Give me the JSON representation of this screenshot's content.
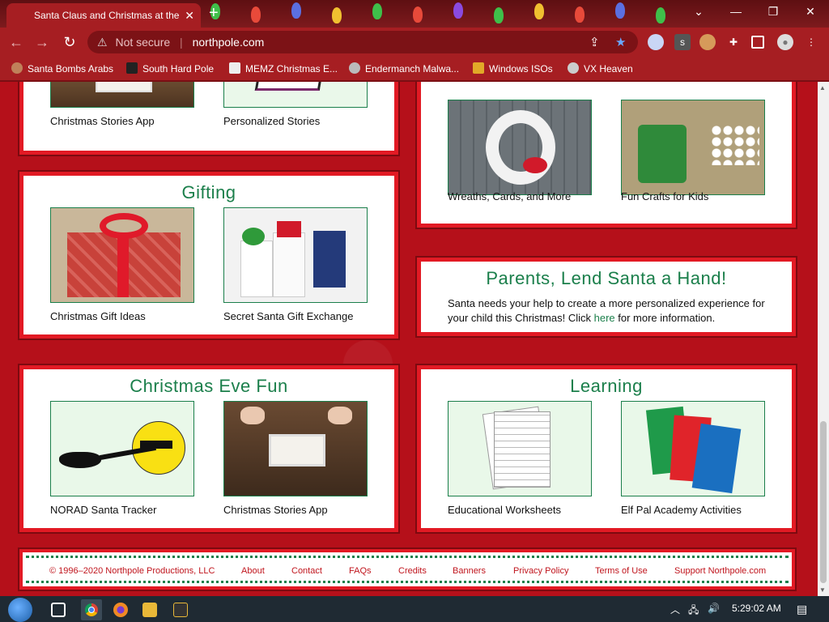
{
  "browser": {
    "tab_title": "Santa Claus and Christmas at the",
    "tab_close": "✕",
    "new_tab": "+",
    "window_controls": {
      "list": "⌄",
      "minimize": "—",
      "restore": "❐",
      "close": "✕"
    },
    "nav": {
      "back": "←",
      "forward": "→",
      "reload": "↻"
    },
    "not_secure": "Not secure",
    "url": "northpole.com",
    "bookmarks": [
      "Santa Bombs Arabs",
      "South Hard Pole",
      "MEMZ Christmas E...",
      "Endermanch Malwa...",
      "Windows ISOs",
      "VX Heaven"
    ]
  },
  "page": {
    "top_left_panel": {
      "items": [
        {
          "caption": "Christmas Stories App",
          "image": "stories-app-image"
        },
        {
          "caption": "Personalized Stories",
          "image": "personalized-book-image"
        }
      ]
    },
    "top_right_panel": {
      "items": [
        {
          "caption": "Wreaths, Cards, and More",
          "image": "wreath-image"
        },
        {
          "caption": "Fun Crafts for Kids",
          "image": "crafts-image"
        }
      ]
    },
    "gifting": {
      "title": "Gifting",
      "items": [
        {
          "caption": "Christmas Gift Ideas",
          "image": "gift-box-image"
        },
        {
          "caption": "Secret Santa Gift Exchange",
          "image": "gift-bags-image"
        }
      ]
    },
    "parents": {
      "title": "Parents, Lend Santa a Hand!",
      "text_before": "Santa needs your help to create a more personalized experience for your child this Christmas! Click ",
      "link": "here",
      "text_after": " for more information."
    },
    "eve_fun": {
      "title": "Christmas Eve Fun",
      "items": [
        {
          "caption": "NORAD Santa Tracker",
          "image": "sleigh-moon-image"
        },
        {
          "caption": "Christmas Stories App",
          "image": "stories-app-image"
        }
      ]
    },
    "learning": {
      "title": "Learning",
      "items": [
        {
          "caption": "Educational Worksheets",
          "image": "worksheets-image"
        },
        {
          "caption": "Elf Pal Academy Activities",
          "image": "math-cards-image"
        }
      ]
    },
    "footer": {
      "copyright": "© 1996–2020 Northpole Productions, LLC",
      "links": [
        "About",
        "Contact",
        "FAQs",
        "Credits",
        "Banners",
        "Privacy Policy",
        "Terms of Use",
        "Support Northpole.com"
      ]
    }
  },
  "taskbar": {
    "clock": "5:29:02 AM",
    "tray_icons": [
      "chevron-up-icon",
      "network-icon",
      "volume-icon"
    ],
    "notification": "notification-icon"
  },
  "colors": {
    "accent_red": "#e21a24",
    "green": "#1b7f4b",
    "bg_red": "#b5101a"
  }
}
